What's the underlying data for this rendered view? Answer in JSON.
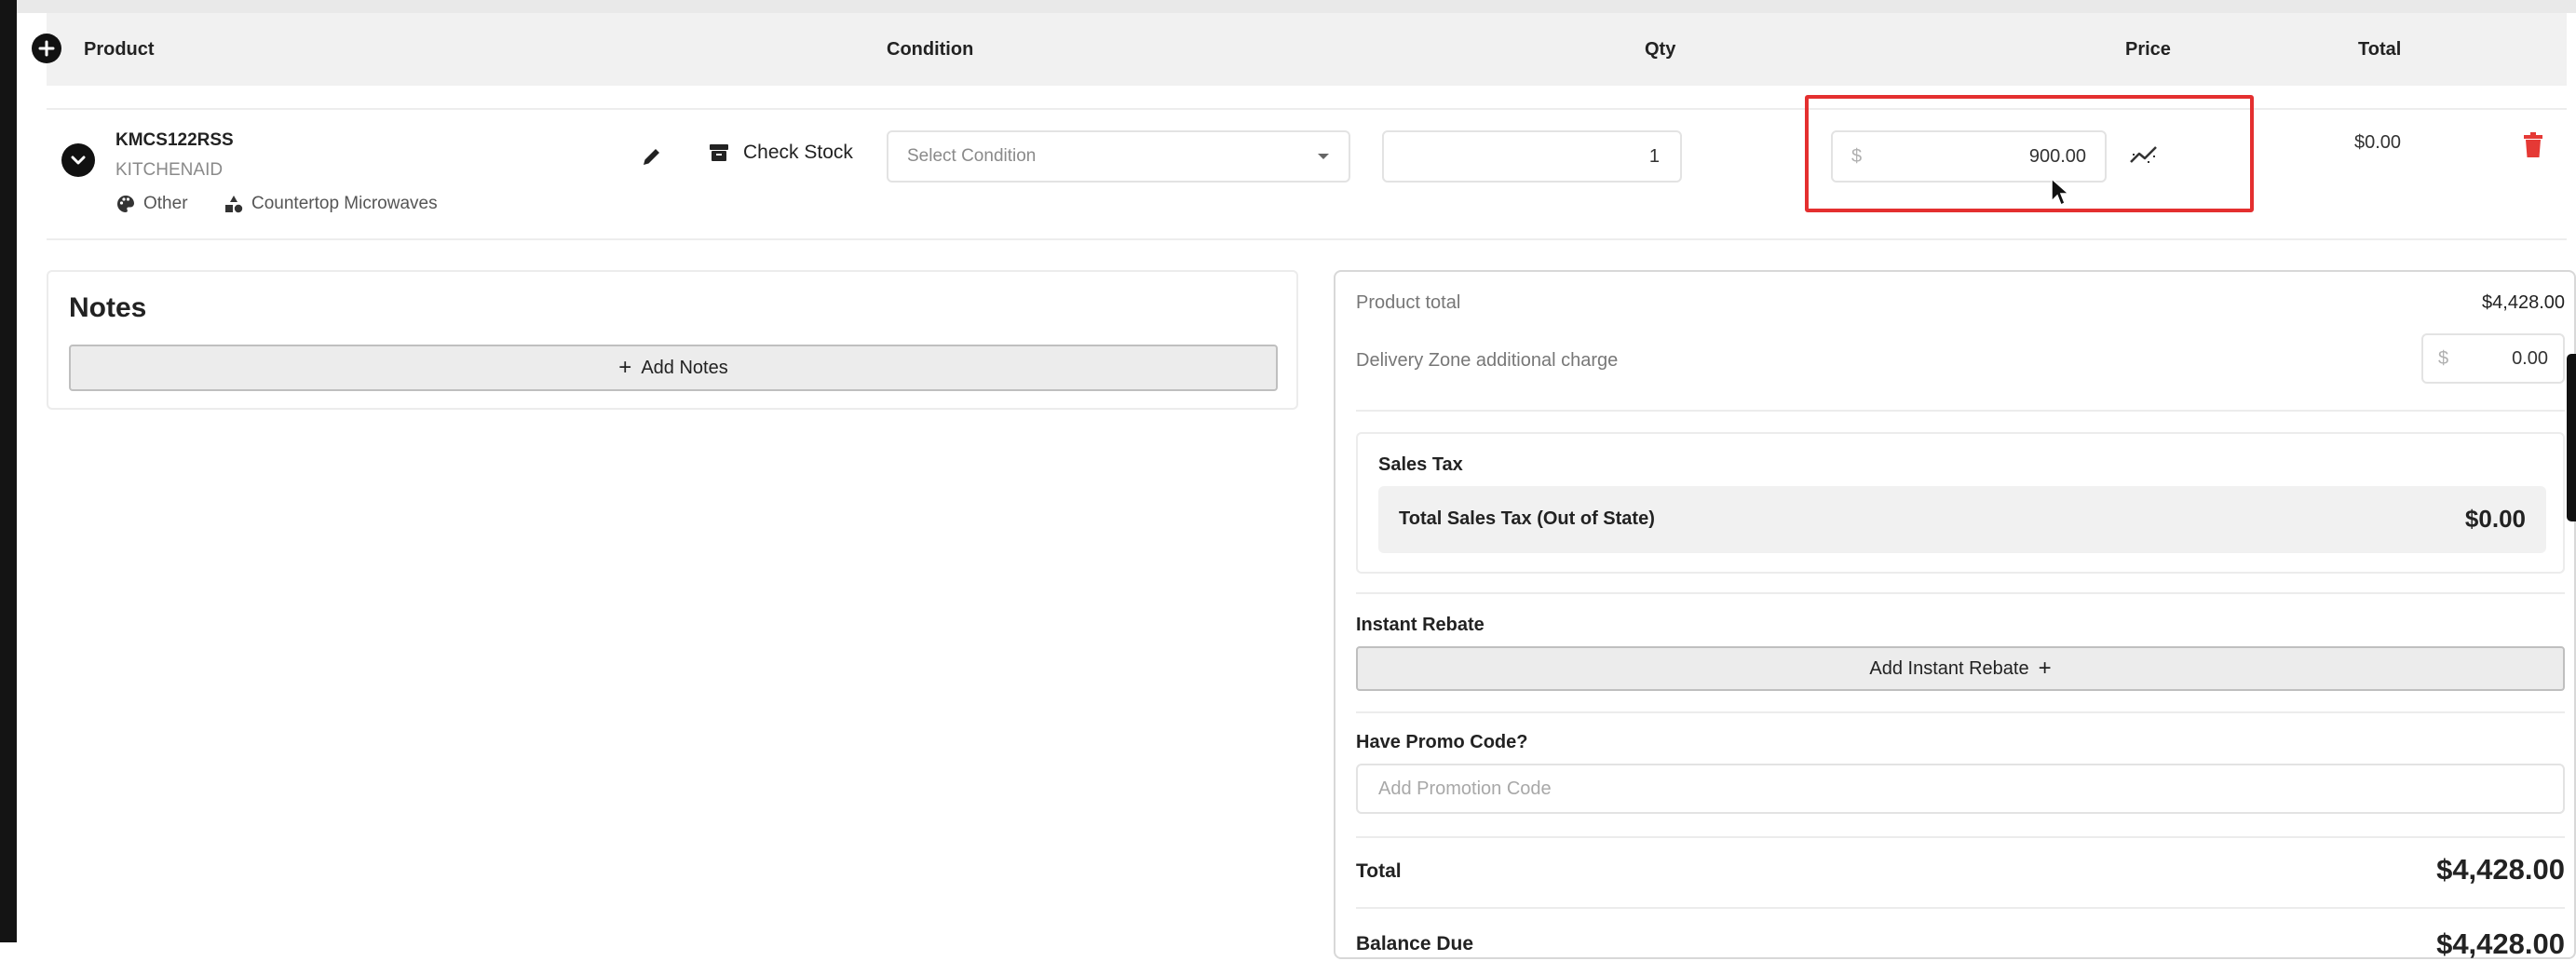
{
  "table": {
    "headers": {
      "product": "Product",
      "condition": "Condition",
      "qty": "Qty",
      "price": "Price",
      "total": "Total"
    }
  },
  "row": {
    "sku": "KMCS122RSS",
    "brand": "KITCHENAID",
    "tag_color": "Other",
    "tag_category": "Countertop Microwaves",
    "check_stock": "Check Stock",
    "condition_placeholder": "Select Condition",
    "qty": "1",
    "currency_symbol": "$",
    "price": "900.00",
    "total": "$0.00"
  },
  "notes": {
    "title": "Notes",
    "add_label": "Add Notes"
  },
  "summary": {
    "product_total_label": "Product total",
    "product_total_value": "$4,428.00",
    "delivery_label": "Delivery Zone additional charge",
    "delivery_currency": "$",
    "delivery_value": "0.00",
    "sales_tax_title": "Sales Tax",
    "sales_tax_row_label": "Total Sales Tax (Out of State)",
    "sales_tax_row_value": "$0.00",
    "rebate_title": "Instant Rebate",
    "rebate_button": "Add Instant Rebate",
    "promo_title": "Have Promo Code?",
    "promo_placeholder": "Add Promotion Code",
    "total_label": "Total",
    "total_value": "$4,428.00",
    "balance_label": "Balance Due",
    "balance_value": "$4,428.00"
  },
  "colors": {
    "highlight": "#e42f2f",
    "delete": "#e53935",
    "header_bg": "#f1f1f1"
  },
  "icons": {
    "add": "plus-circle-icon",
    "expand": "chevron-down-icon",
    "edit": "pencil-icon",
    "stock": "archive-icon",
    "palette": "palette-icon",
    "category": "shapes-icon",
    "trend": "chart-trend-icon",
    "delete": "trash-icon",
    "cursor": "mouse-pointer-icon"
  }
}
